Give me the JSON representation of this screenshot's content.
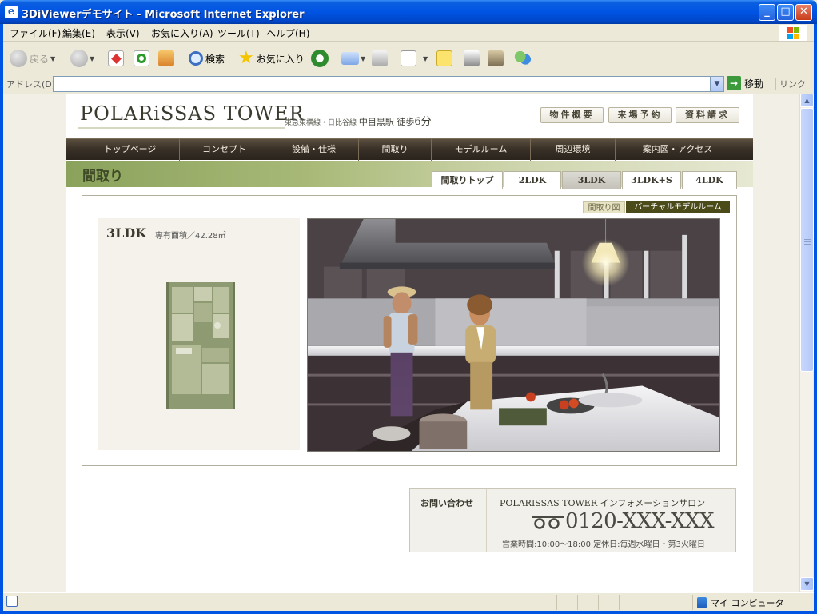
{
  "window": {
    "title": "3DiViewerデモサイト - Microsoft Internet Explorer",
    "app_icon_glyph": "e",
    "btn_minimize": "_",
    "btn_maximize": "□",
    "btn_close": "✕"
  },
  "menu": [
    "ファイル(F)",
    "編集(E)",
    "表示(V)",
    "お気に入り(A)",
    "ツール(T)",
    "ヘルプ(H)"
  ],
  "toolbar": {
    "back_label": "戻る",
    "search_label": "検索",
    "favorites_label": "お気に入り"
  },
  "addressbar": {
    "label": "アドレス(D)",
    "url": "",
    "go_label": "移動",
    "links_label": "リンク"
  },
  "site": {
    "logo": "POLARiSSAS TOWER",
    "access_line": "東急東横線・日比谷線",
    "access_station": "中目黒駅 徒歩",
    "access_minutes": "6分",
    "top_buttons": [
      "物件概要",
      "来場予約",
      "資料請求"
    ],
    "global_nav": [
      "トップページ",
      "コンセプト",
      "設備・仕様",
      "間取り",
      "モデルルーム",
      "周辺環境",
      "案内図・アクセス"
    ],
    "section_title": "間取り",
    "tabs": [
      "間取りトップ",
      "2LDK",
      "3LDK",
      "3LDK+S",
      "4LDK"
    ],
    "active_tab": "3LDK",
    "tag_plan": "間取り図",
    "tag_virtual": "バーチャルモデルルーム",
    "plan_type": "3LDK",
    "plan_area": "専有面積／42.28㎡",
    "contact": {
      "label": "お問い合わせ",
      "name": "POLARISSAS TOWER インフォメーションサロン",
      "freedial_mark": "FD",
      "phone": "0120-XXX-XXX",
      "hours": "営業時間:10:00〜18:00 定休日:毎週水曜日・第3火曜日"
    }
  },
  "statusbar": {
    "zone": "マイ コンピュータ"
  },
  "colors": {
    "xp_blue": "#0054e3",
    "nav_brown": "#3a3128",
    "olive_green": "#8aa25c",
    "virtual_tag": "#4b4a19",
    "plan_green": "#8d9a72"
  }
}
